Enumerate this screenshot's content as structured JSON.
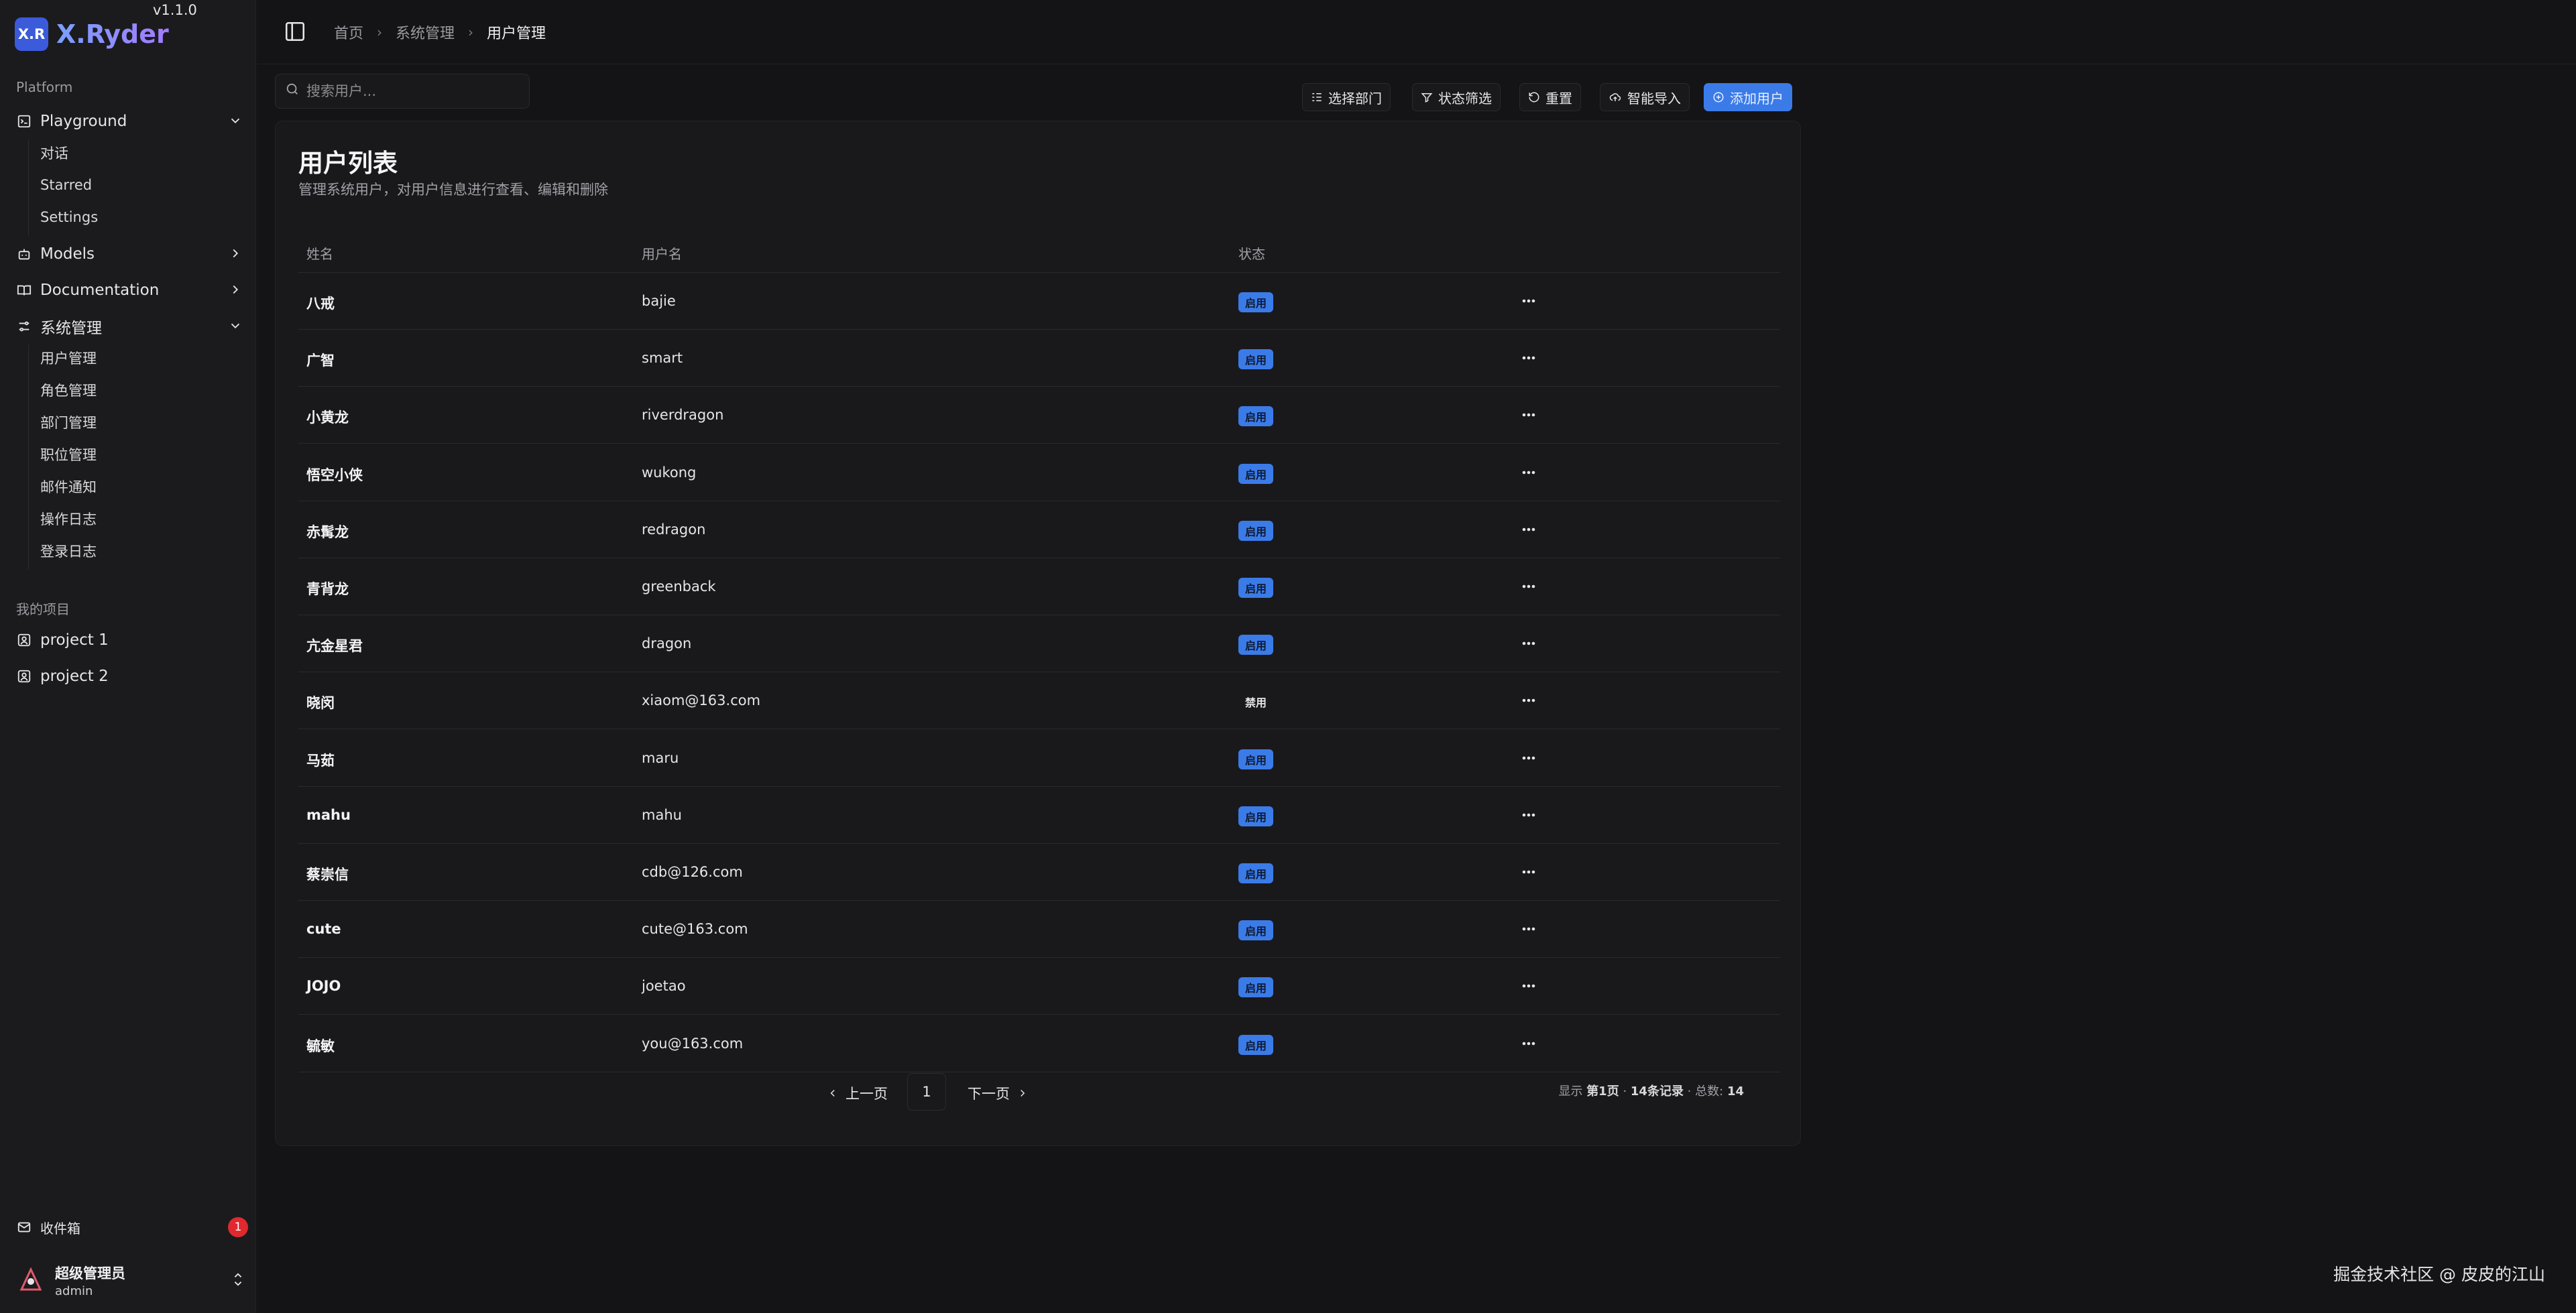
{
  "brand": {
    "logo": "X.R",
    "name": "X.Ryder",
    "version": "v1.1.0"
  },
  "sidebar": {
    "platform_label": "Platform",
    "items": [
      {
        "label": "Playground",
        "icon": "terminal-icon",
        "expanded": true,
        "children": [
          "对话",
          "Starred",
          "Settings"
        ]
      },
      {
        "label": "Models",
        "icon": "bot-icon",
        "expanded": false
      },
      {
        "label": "Documentation",
        "icon": "book-icon",
        "expanded": false
      },
      {
        "label": "系统管理",
        "icon": "settings-sliders-icon",
        "expanded": true,
        "children": [
          "用户管理",
          "角色管理",
          "部门管理",
          "职位管理",
          "邮件通知",
          "操作日志",
          "登录日志"
        ]
      }
    ],
    "projects_label": "我的项目",
    "projects": [
      "project 1",
      "project 2"
    ],
    "inbox": {
      "label": "收件箱",
      "count": "1"
    },
    "user": {
      "name": "超级管理员",
      "username": "admin"
    }
  },
  "header": {
    "breadcrumb": [
      "首页",
      "系统管理",
      "用户管理"
    ]
  },
  "toolbar": {
    "search_placeholder": "搜索用户...",
    "dept_label": "选择部门",
    "status_label": "状态筛选",
    "reset_label": "重置",
    "import_label": "智能导入",
    "add_label": "添加用户"
  },
  "card": {
    "title": "用户列表",
    "description": "管理系统用户，对用户信息进行查看、编辑和删除"
  },
  "table": {
    "columns": [
      "姓名",
      "用户名",
      "状态"
    ],
    "rows": [
      {
        "name": "八戒",
        "username": "bajie",
        "status": "启用",
        "enabled": true
      },
      {
        "name": "广智",
        "username": "smart",
        "status": "启用",
        "enabled": true
      },
      {
        "name": "小黄龙",
        "username": "riverdragon",
        "status": "启用",
        "enabled": true
      },
      {
        "name": "悟空小侠",
        "username": "wukong",
        "status": "启用",
        "enabled": true
      },
      {
        "name": "赤髯龙",
        "username": "redragon",
        "status": "启用",
        "enabled": true
      },
      {
        "name": "青背龙",
        "username": "greenback",
        "status": "启用",
        "enabled": true
      },
      {
        "name": "亢金星君",
        "username": "dragon",
        "status": "启用",
        "enabled": true
      },
      {
        "name": "晓闵",
        "username": "xiaom@163.com",
        "status": "禁用",
        "enabled": false
      },
      {
        "name": "马茹",
        "username": "maru",
        "status": "启用",
        "enabled": true
      },
      {
        "name": "mahu",
        "username": "mahu",
        "status": "启用",
        "enabled": true
      },
      {
        "name": "蔡崇信",
        "username": "cdb@126.com",
        "status": "启用",
        "enabled": true
      },
      {
        "name": "cute",
        "username": "cute@163.com",
        "status": "启用",
        "enabled": true
      },
      {
        "name": "JOJO",
        "username": "joetao",
        "status": "启用",
        "enabled": true
      },
      {
        "name": "毓敏",
        "username": "you@163.com",
        "status": "启用",
        "enabled": true
      }
    ]
  },
  "pagination": {
    "prev": "上一页",
    "next": "下一页",
    "current": "1",
    "info_prefix": "显示",
    "info_page": "第1页",
    "info_records": "14条记录",
    "info_total_label": "总数:",
    "info_total": "14"
  },
  "watermark": "掘金技术社区 @ 皮皮的江山",
  "colors": {
    "accent": "#3b7be8",
    "background": "#141416",
    "sidebar": "#1b1b1e",
    "badge": "#e0292f"
  }
}
